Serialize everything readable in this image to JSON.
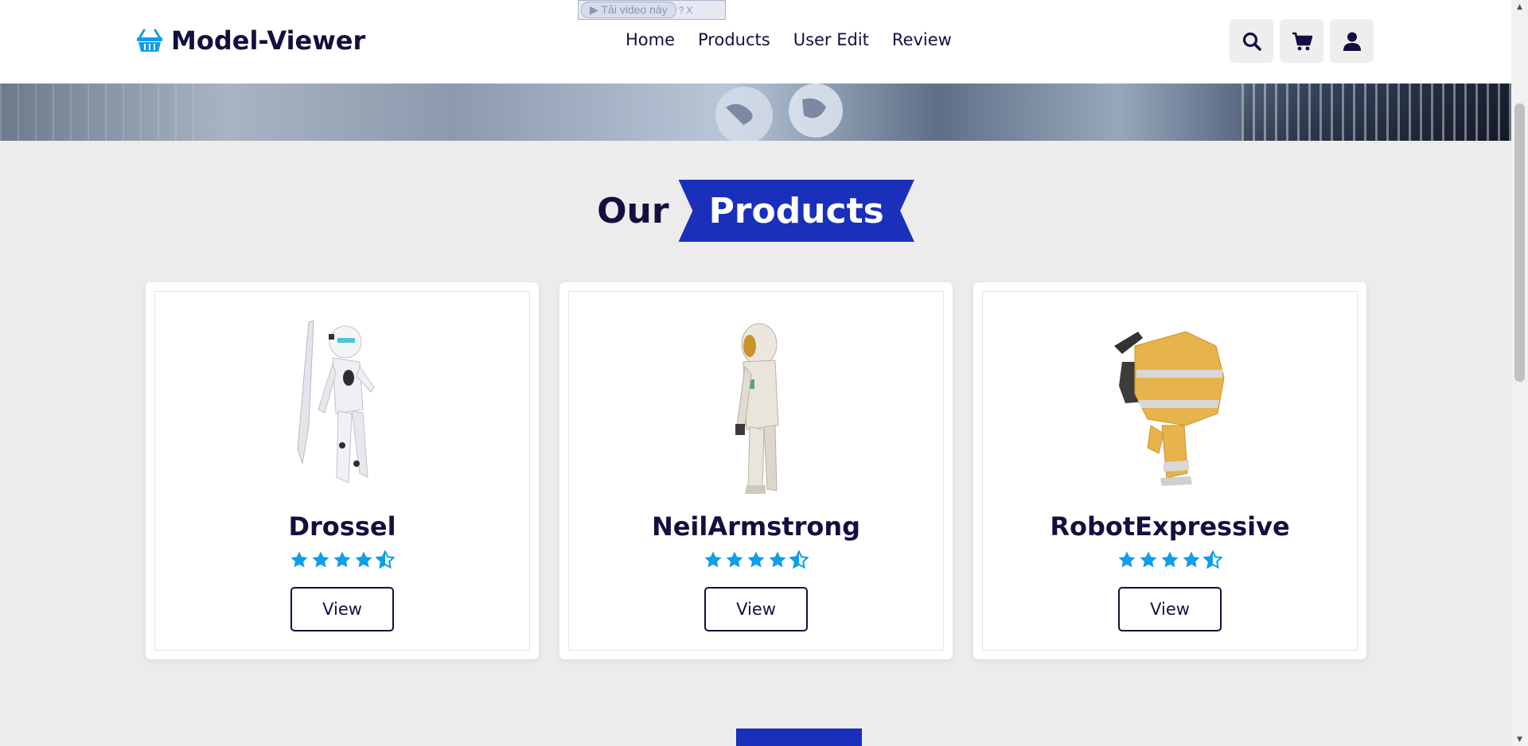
{
  "brand": {
    "name": "Model-Viewer",
    "icon": "shopping-basket-icon",
    "accent": "#0f9ee8"
  },
  "nav": {
    "items": [
      {
        "label": "Home"
      },
      {
        "label": "Products"
      },
      {
        "label": "User Edit"
      },
      {
        "label": "Review"
      }
    ]
  },
  "header_icons": [
    "search-icon",
    "cart-icon",
    "user-icon"
  ],
  "video_widget": {
    "button_label": "▶ Tải video này",
    "help": "?",
    "close": "X"
  },
  "section": {
    "word1": "Our",
    "word2": "Products",
    "ribbon_color": "#1a2fba"
  },
  "products": [
    {
      "name": "Drossel",
      "rating": 4.5,
      "button": "View"
    },
    {
      "name": "NeilArmstrong",
      "rating": 4.5,
      "button": "View"
    },
    {
      "name": "RobotExpressive",
      "rating": 4.5,
      "button": "View"
    }
  ],
  "colors": {
    "text": "#130f40",
    "star": "#0f9ee8",
    "background": "#ececec"
  }
}
